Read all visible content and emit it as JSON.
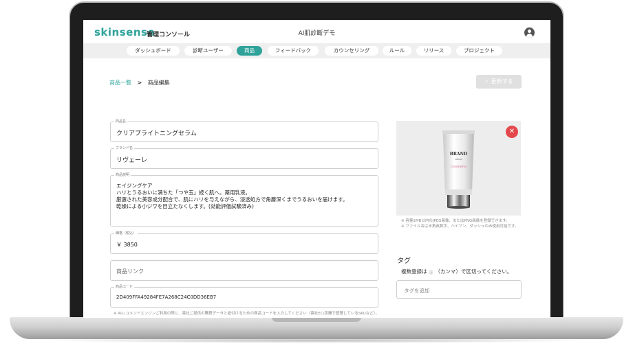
{
  "header": {
    "brand": "skinsense",
    "brand_sub": "管理コンソール",
    "title": "AI肌診断デモ"
  },
  "nav": {
    "items": [
      {
        "label": "ダッシュボード",
        "active": false
      },
      {
        "label": "診断ユーザー",
        "active": false
      },
      {
        "label": "商品",
        "active": true
      },
      {
        "label": "フィードバック",
        "active": false
      },
      {
        "label": "カウンセリング",
        "active": false
      },
      {
        "label": "ルール",
        "active": false
      },
      {
        "label": "リリース",
        "active": false
      },
      {
        "label": "プロジェクト",
        "active": false
      }
    ]
  },
  "breadcrumb": {
    "list_link": "商品一覧",
    "separator": ">",
    "current": "商品編集"
  },
  "update_button": {
    "label": "更新する",
    "icon": "check-icon"
  },
  "form": {
    "product_name": {
      "label": "商品名",
      "value": "クリアブライトニングセラム"
    },
    "brand_name": {
      "label": "ブランド名",
      "value": "リヴェーレ"
    },
    "description": {
      "label": "商品説明",
      "lines": [
        "エイジングケア",
        "ハリとうるおいに満ちた「つや玉」続く肌へ。薬用乳液。",
        "厳選された美容成分配合で、肌にハリを与えながら、浸透処方で角層深くまでうるおいを届けます。",
        "乾燥による小ジワを目立たなくします。(効能評価試験済み)"
      ]
    },
    "price": {
      "label": "価格（税込）",
      "value": "￥ 3850"
    },
    "product_link": {
      "placeholder": "商品リンク"
    },
    "product_code": {
      "label": "商品コード",
      "value": "2D409FFA49284FE7A268C24C0DD36EB7"
    },
    "code_note": "※ AIレコメンドエンジンご利用の際に、貴社ご提供の購買データと紐付けるための商品コードを入力してください（貴社EC/店舗で管理しているSKUなど）。"
  },
  "image": {
    "close_icon": "close-icon",
    "tube_brand": "BRAND",
    "tube_sub": "CREAM",
    "tube_script": "Cosmetic",
    "notes": [
      "※ 容量1MB以内のJPEG画像、またはPNG画像を登録できます。",
      "※ ファイル名は半角英数字、ハイフン、ダッシュのみ使用可能です。"
    ]
  },
  "tags": {
    "title": "タグ",
    "help_before": "複数登録は",
    "help_comma": ",",
    "help_after": "（カンマ）で区切ってください。",
    "placeholder": "タグを追加"
  },
  "colors": {
    "accent": "#2fa39a",
    "close": "#e4474b",
    "disabled": "#e0e0e0"
  }
}
